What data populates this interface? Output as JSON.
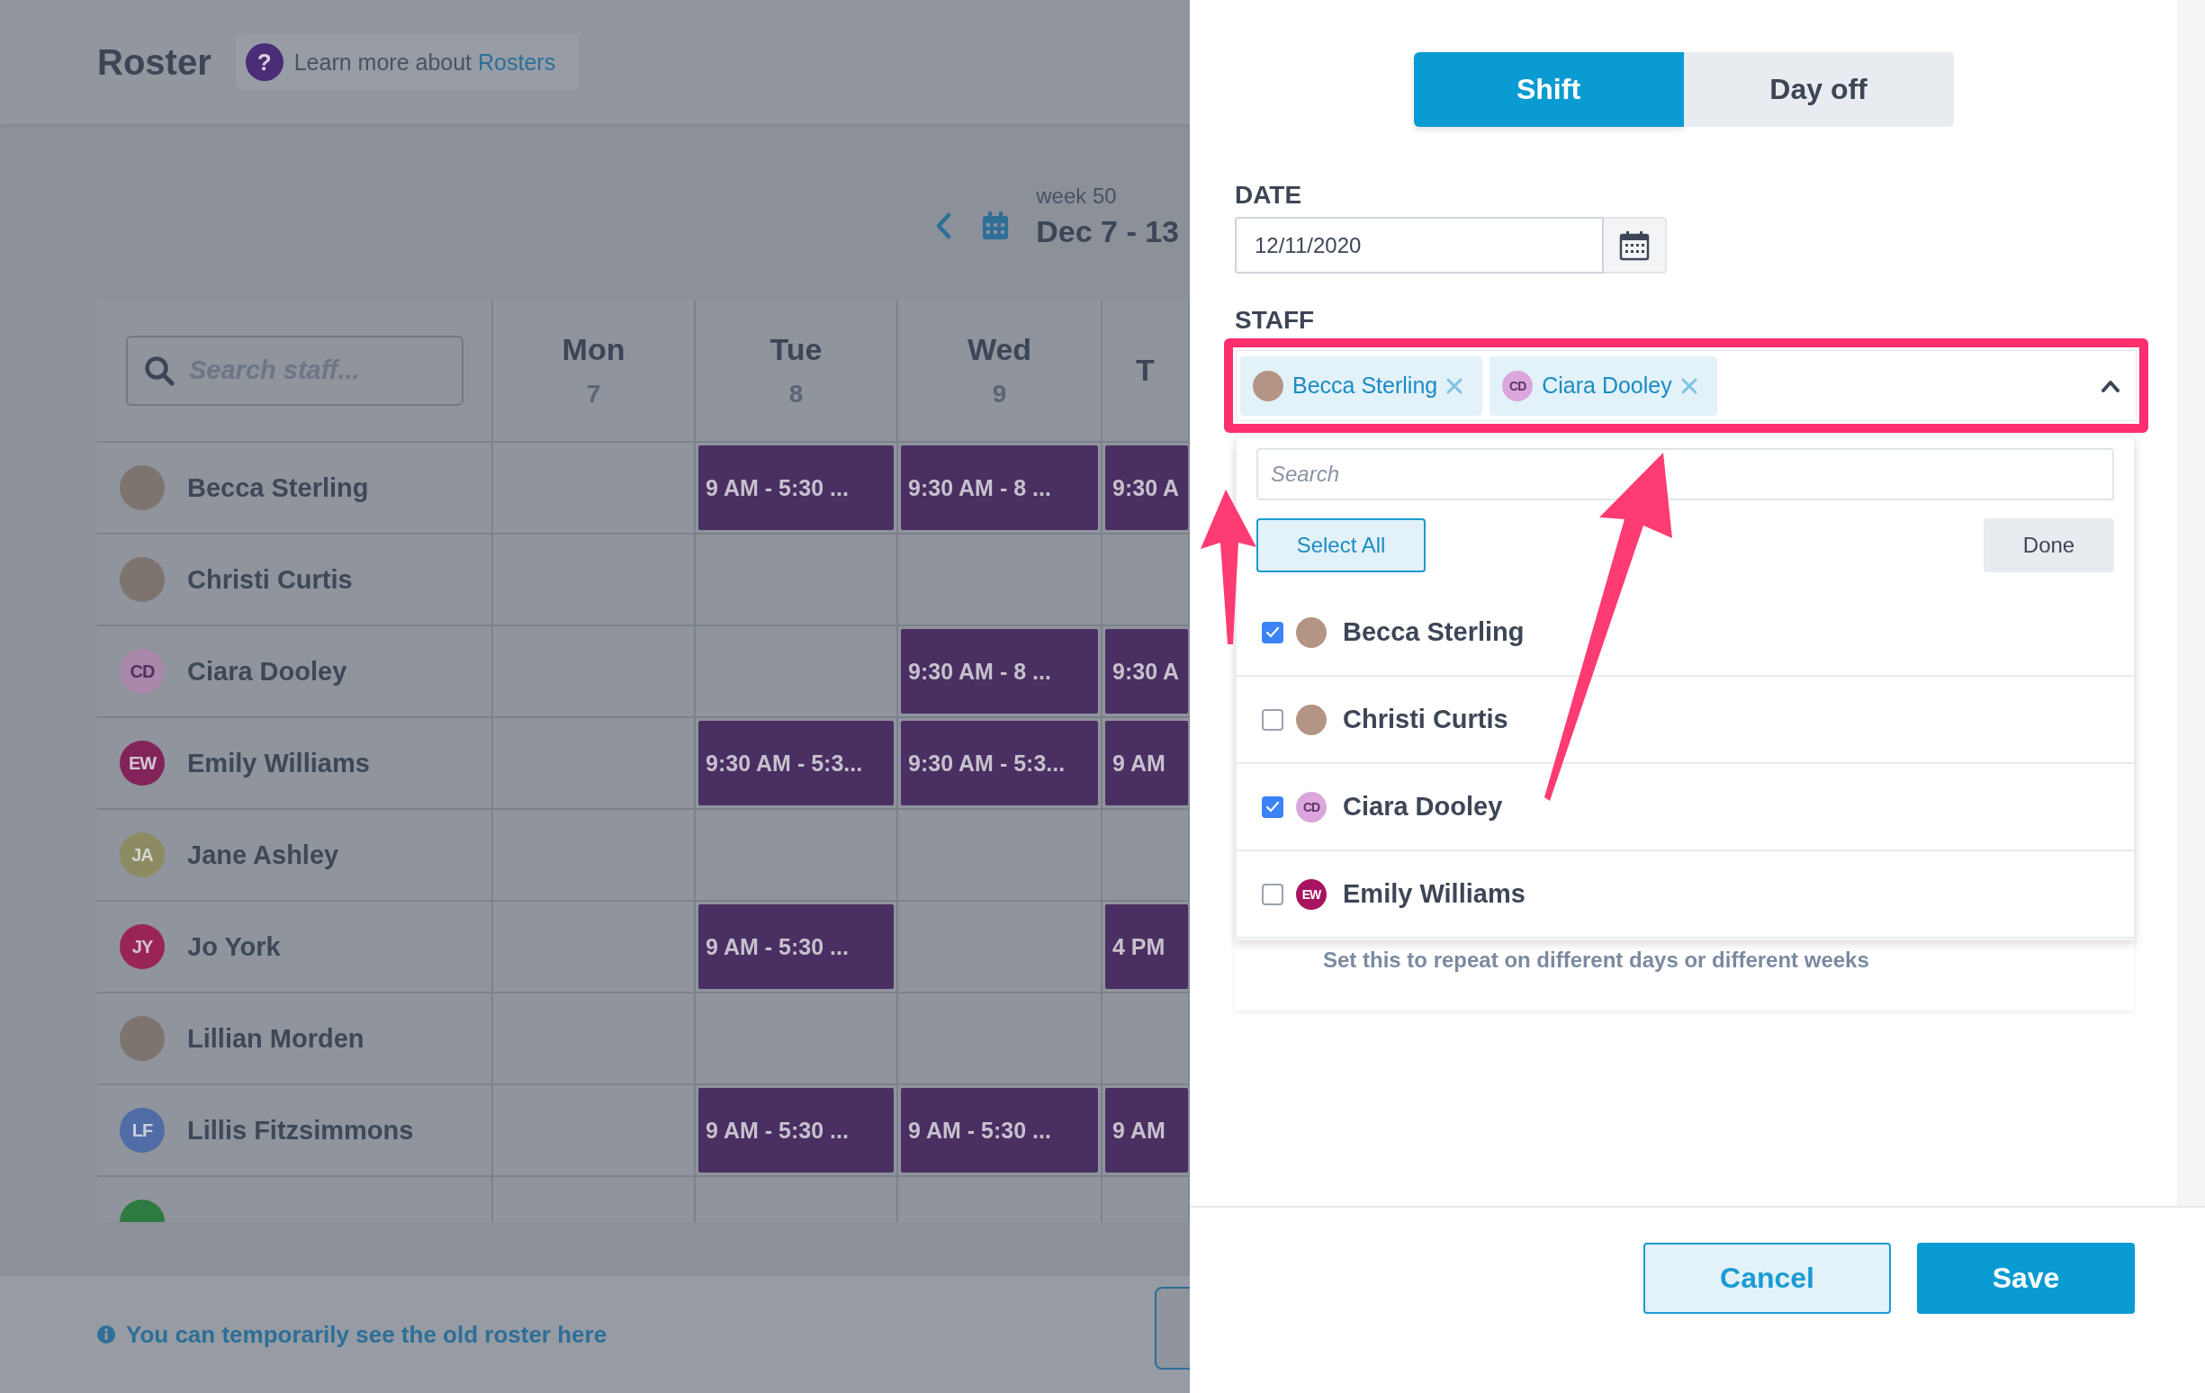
{
  "roster": {
    "title": "Roster",
    "help": {
      "icon": "?",
      "text": "Learn more about",
      "link": "Rosters"
    },
    "week_label": "week 50",
    "date_range": "Dec 7 - 13",
    "search_placeholder": "Search staff...",
    "days": [
      {
        "name": "Mon",
        "date": "7"
      },
      {
        "name": "Tue",
        "date": "8"
      },
      {
        "name": "Wed",
        "date": "9"
      },
      {
        "name": "T"
      }
    ],
    "rows": [
      {
        "name": "Becca Sterling",
        "avatar": {
          "kind": "photo"
        },
        "cells": [
          {
            "kind": "empty"
          },
          {
            "kind": "shift",
            "text": "9 AM - 5:30 ..."
          },
          {
            "kind": "shift",
            "text": "9:30 AM - 8 ..."
          },
          {
            "kind": "shift",
            "text": "9:30 A"
          }
        ]
      },
      {
        "name": "Christi Curtis",
        "avatar": {
          "kind": "photo"
        },
        "cells": [
          {
            "kind": "empty"
          },
          {
            "kind": "empty"
          },
          {
            "kind": "empty"
          },
          {
            "kind": "empty"
          }
        ]
      },
      {
        "name": "Ciara Dooley",
        "avatar": {
          "kind": "initials",
          "initials": "CD",
          "color": "#a988aa"
        },
        "cells": [
          {
            "kind": "empty"
          },
          {
            "kind": "empty"
          },
          {
            "kind": "shift",
            "text": "9:30 AM - 8 ..."
          },
          {
            "kind": "shift",
            "text": "9:30 A"
          }
        ]
      },
      {
        "name": "Emily Williams",
        "avatar": {
          "kind": "initials",
          "initials": "EW",
          "color": "#822359"
        },
        "cells": [
          {
            "kind": "empty"
          },
          {
            "kind": "shift",
            "text": "9:30 AM - 5:3..."
          },
          {
            "kind": "shift",
            "text": "9:30 AM - 5:3..."
          },
          {
            "kind": "shift",
            "text": "9 AM"
          }
        ]
      },
      {
        "name": "Jane Ashley",
        "avatar": {
          "kind": "initials",
          "initials": "JA",
          "color": "#8c8b62"
        },
        "cells": [
          {
            "kind": "empty"
          },
          {
            "kind": "empty"
          },
          {
            "kind": "empty"
          },
          {
            "kind": "empty"
          }
        ]
      },
      {
        "name": "Jo York",
        "avatar": {
          "kind": "initials",
          "initials": "JY",
          "color": "#982553"
        },
        "cells": [
          {
            "kind": "empty"
          },
          {
            "kind": "shift",
            "text": "9 AM - 5:30 ..."
          },
          {
            "kind": "empty"
          },
          {
            "kind": "shift",
            "text": "4 PM"
          }
        ]
      },
      {
        "name": "Lillian Morden",
        "avatar": {
          "kind": "photo"
        },
        "cells": [
          {
            "kind": "empty"
          },
          {
            "kind": "empty"
          },
          {
            "kind": "empty"
          },
          {
            "kind": "empty"
          }
        ]
      },
      {
        "name": "Lillis Fitzsimmons",
        "avatar": {
          "kind": "initials",
          "initials": "LF",
          "color": "#506ca5"
        },
        "cells": [
          {
            "kind": "empty"
          },
          {
            "kind": "shift",
            "text": "9 AM - 5:30 ..."
          },
          {
            "kind": "shift",
            "text": "9 AM - 5:30 ..."
          },
          {
            "kind": "shift",
            "text": "9 AM"
          }
        ]
      },
      {
        "avatar": {
          "kind": "initials",
          "color": "#2f7a40"
        },
        "cells": [
          {
            "kind": "empty"
          },
          {
            "kind": "empty"
          },
          {
            "kind": "empty"
          },
          {
            "kind": "empty"
          }
        ]
      }
    ],
    "footer_note": "You can temporarily see the old roster here"
  },
  "panel": {
    "tabs": [
      {
        "label": "Shift",
        "selected": true
      },
      {
        "label": "Day off",
        "selected": false
      }
    ],
    "date": {
      "label": "DATE",
      "value": "12/11/2020"
    },
    "staff": {
      "label": "STAFF",
      "expanded": true,
      "chips": [
        {
          "name": "Becca Sterling",
          "avatar": {
            "kind": "photo"
          }
        },
        {
          "name": "Ciara Dooley",
          "avatar": {
            "kind": "initials",
            "initials": "CD",
            "color": "#dba6dc"
          }
        }
      ],
      "dropdown": {
        "placeholder": "Search",
        "select_all": "Select All",
        "done": "Done",
        "items": [
          {
            "name": "Becca Sterling",
            "avatar": {
              "kind": "photo"
            },
            "checked": true
          },
          {
            "name": "Christi Curtis",
            "avatar": {
              "kind": "photo"
            },
            "checked": false
          },
          {
            "name": "Ciara Dooley",
            "avatar": {
              "kind": "initials",
              "initials": "CD",
              "color": "#dba6dc"
            },
            "checked": true
          },
          {
            "name": "Emily Williams",
            "avatar": {
              "kind": "initials",
              "initials": "EW",
              "color": "#a8145f"
            },
            "checked": false
          }
        ]
      }
    },
    "repeat": {
      "description": "Set this to repeat on different days or different weeks"
    },
    "buttons": [
      {
        "label": "Cancel",
        "kind": "secondary"
      },
      {
        "label": "Save",
        "kind": "primary"
      }
    ]
  }
}
